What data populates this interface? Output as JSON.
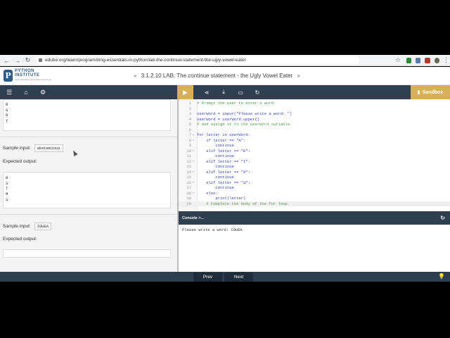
{
  "browser": {
    "url": "edube.org/learn/programming-essentials-in-python/lab-the-continue-statement-the-ugly-vowel-eater"
  },
  "header": {
    "logo_line1": "PYTHON",
    "logo_line2": "INSTITUTE",
    "logo_tagline": "Open Education & Development Group",
    "lesson_title": "3.1.2.10 LAB: The continue statement - the Ugly Vowel Eater",
    "prev_arrow": "«",
    "next_arrow": "»"
  },
  "toolbar": {
    "sandbox_label": "Sandbox"
  },
  "left_pane": {
    "first_output_lines": [
      "R",
      "G",
      "R",
      "Y"
    ],
    "sample_input_label_1": "Sample input:",
    "sample_input_value_1": "abstemious",
    "expected_output_label_1": "Expected output:",
    "second_output_lines": [
      "B",
      "S",
      "T",
      "M",
      "S"
    ],
    "sample_input_label_2": "Sample input:",
    "sample_input_value_2": "IOUEA",
    "expected_output_label_2": "Expected output:"
  },
  "editor": {
    "lines": [
      {
        "n": "1",
        "fold": "",
        "code": "# Prompt the user to enter a word",
        "comment": true
      },
      {
        "n": "2",
        "fold": "",
        "code": "",
        "comment": false
      },
      {
        "n": "3",
        "fold": "",
        "code": "userWord = input(\"Please write a word: \")",
        "comment": false
      },
      {
        "n": "4",
        "fold": "",
        "code": "userWord = userWord.upper()",
        "comment": false
      },
      {
        "n": "5",
        "fold": "",
        "code": "# and assign it to the userWord variable.",
        "comment": true
      },
      {
        "n": "6",
        "fold": "",
        "code": "",
        "comment": false
      },
      {
        "n": "7",
        "fold": "▾",
        "code": "for letter in userWord:",
        "comment": false
      },
      {
        "n": "8",
        "fold": "▾",
        "code": "    if letter == \"A\":",
        "comment": false
      },
      {
        "n": "9",
        "fold": "",
        "code": "        continue",
        "comment": false
      },
      {
        "n": "10",
        "fold": "▾",
        "code": "    elif letter == \"E\":",
        "comment": false
      },
      {
        "n": "11",
        "fold": "",
        "code": "        continue",
        "comment": false
      },
      {
        "n": "12",
        "fold": "▾",
        "code": "    elif letter == \"I\":",
        "comment": false
      },
      {
        "n": "13",
        "fold": "",
        "code": "        continue",
        "comment": false
      },
      {
        "n": "14",
        "fold": "▾",
        "code": "    elif letter == \"O\":",
        "comment": false
      },
      {
        "n": "15",
        "fold": "",
        "code": "        continue",
        "comment": false
      },
      {
        "n": "16",
        "fold": "▾",
        "code": "    elif letter == \"U\":",
        "comment": false
      },
      {
        "n": "17",
        "fold": "",
        "code": "        continue",
        "comment": false
      },
      {
        "n": "18",
        "fold": "▾",
        "code": "    else:",
        "comment": false
      },
      {
        "n": "19",
        "fold": "",
        "code": "        print(letter)",
        "comment": false
      },
      {
        "n": "20",
        "fold": "",
        "code": "    # Complete the body of the for loop.",
        "comment": true
      }
    ],
    "active_line": 20
  },
  "console": {
    "title": "Console >...",
    "output": "Please write a word: IOUEA"
  },
  "footer": {
    "prev_label": "Prev",
    "next_label": "Next"
  }
}
